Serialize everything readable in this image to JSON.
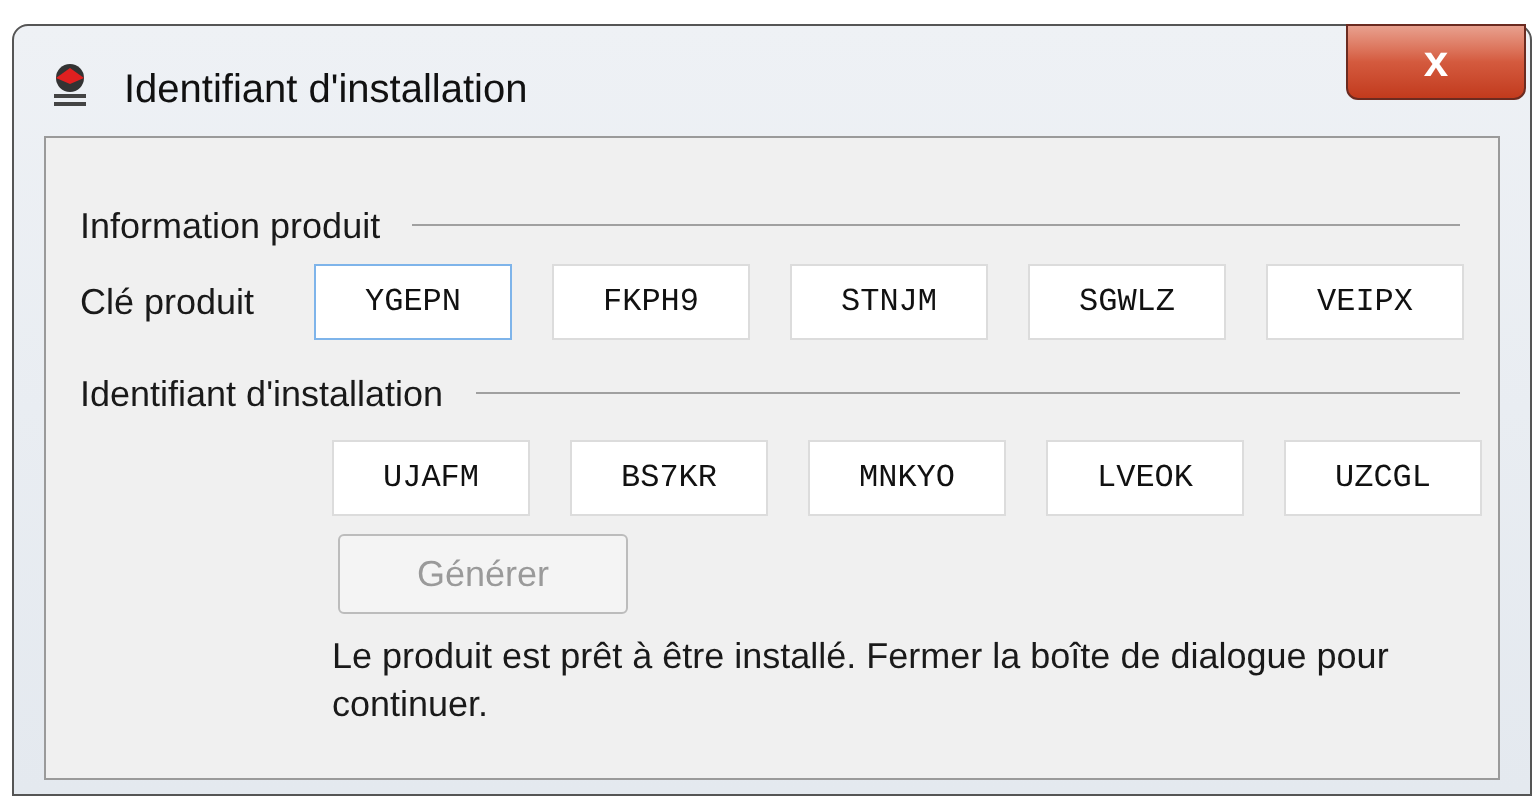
{
  "window": {
    "title": "Identifiant d'installation",
    "close_label": "x"
  },
  "product_section": {
    "title": "Information produit",
    "key_label": "Clé produit",
    "key_fields": [
      {
        "value": "YGEPN",
        "focused": true
      },
      {
        "value": "FKPH9",
        "focused": false
      },
      {
        "value": "STNJM",
        "focused": false
      },
      {
        "value": "SGWLZ",
        "focused": false
      },
      {
        "value": "VEIPX",
        "focused": false
      }
    ]
  },
  "installation_section": {
    "title": "Identifiant d'installation",
    "id_fields": [
      {
        "value": "UJAFM"
      },
      {
        "value": "BS7KR"
      },
      {
        "value": "MNKYO"
      },
      {
        "value": "LVEOK"
      },
      {
        "value": "UZCGL"
      }
    ],
    "generate_button": {
      "label": "Générer",
      "disabled": true
    },
    "message": "Le produit est prêt à être installé. Fermer la boîte de dialogue pour continuer."
  }
}
